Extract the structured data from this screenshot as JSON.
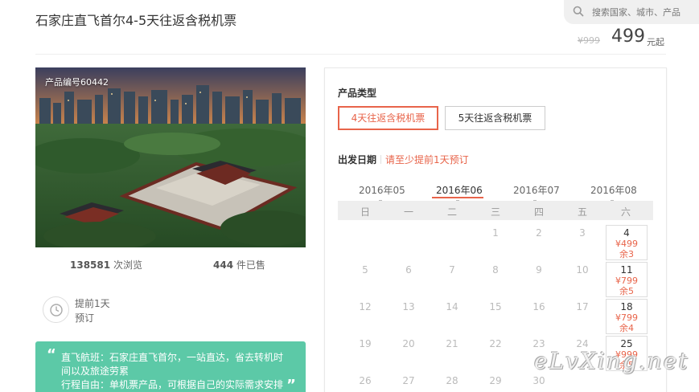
{
  "header": {
    "title": "石家庄直飞首尔4-5天往返含税机票",
    "search_placeholder": "搜索国家、城市、产品"
  },
  "price": {
    "original": "¥999",
    "current": "499",
    "suffix": "元起"
  },
  "product": {
    "code": "产品编号60442",
    "views_number": "138581",
    "views_label": "次浏览",
    "sold_number": "444",
    "sold_label": "件已售",
    "advance_line1": "提前1天",
    "advance_line2": "预订"
  },
  "promo": {
    "line1": "直飞航班：石家庄直飞首尔，一站直达，省去转机时",
    "line2": "间以及旅途劳累",
    "line3": "行程自由：单机票产品，可根据自己的实际需求安排",
    "open_quote": "“",
    "close_quote": "”"
  },
  "booking": {
    "type_label": "产品类型",
    "types": [
      "4天往返含税机票",
      "5天往返含税机票"
    ],
    "date_label": "出发日期",
    "date_hint": "请至少提前1天预订",
    "months": [
      "2016年05",
      "2016年06",
      "2016年07",
      "2016年08"
    ],
    "weekdays": [
      "日",
      "一",
      "二",
      "三",
      "四",
      "五",
      "六"
    ],
    "rows": [
      {
        "days": [
          "",
          "",
          "",
          "1",
          "2",
          "3"
        ],
        "sat": {
          "day": "4",
          "price": "¥499",
          "stock": "余3"
        }
      },
      {
        "days": [
          "5",
          "6",
          "7",
          "8",
          "9",
          "10"
        ],
        "sat": {
          "day": "11",
          "price": "¥799",
          "stock": "余5"
        }
      },
      {
        "days": [
          "12",
          "13",
          "14",
          "15",
          "16",
          "17"
        ],
        "sat": {
          "day": "18",
          "price": "¥799",
          "stock": "余4"
        }
      },
      {
        "days": [
          "19",
          "20",
          "21",
          "22",
          "23",
          "24"
        ],
        "sat": {
          "day": "25",
          "price": "¥999",
          "stock": "余5"
        }
      },
      {
        "days": [
          "26",
          "27",
          "28",
          "29",
          "30",
          ""
        ],
        "sat": null
      }
    ]
  },
  "watermark": "eLvXing.net",
  "colors": {
    "accent": "#e8644a",
    "promo_bg": "#5cc9a7"
  }
}
